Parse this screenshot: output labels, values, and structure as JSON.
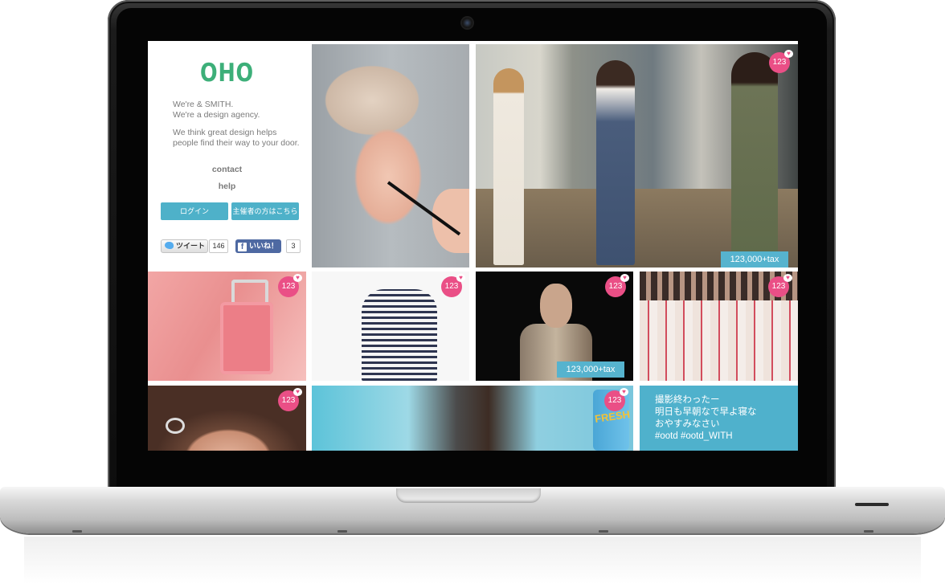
{
  "sidebar": {
    "logo": "OHO",
    "intro_line1": "We're & SMITH.",
    "intro_line2": "We're a design agency.",
    "intro_para": "We think great design helps people find their way to your door.",
    "contact_label": "contact",
    "help_label": "help",
    "login_label": "ログイン",
    "organizer_label": "主催者の方はこちら",
    "tweet_label": "ツイート",
    "tweet_count": "146",
    "like_label": "いいね！",
    "like_count": "3"
  },
  "tiles": {
    "street_price": "123,000+tax",
    "runway_price": "123,000+tax",
    "like_count": "123",
    "can_text": "FRESH",
    "post_lines": [
      "撮影終わったー",
      "明日も早朝なで早よ寝な",
      "おやすみなさい",
      "#ootd #ootd_WITH"
    ]
  },
  "icons": [
    "twitter-icon",
    "facebook-icon",
    "heart-icon",
    "camera-icon"
  ],
  "colors": {
    "brand_green": "#3daf79",
    "accent_blue": "#4eb1c9",
    "like_pink": "#ea4f86",
    "facebook_blue": "#4e69a2"
  }
}
